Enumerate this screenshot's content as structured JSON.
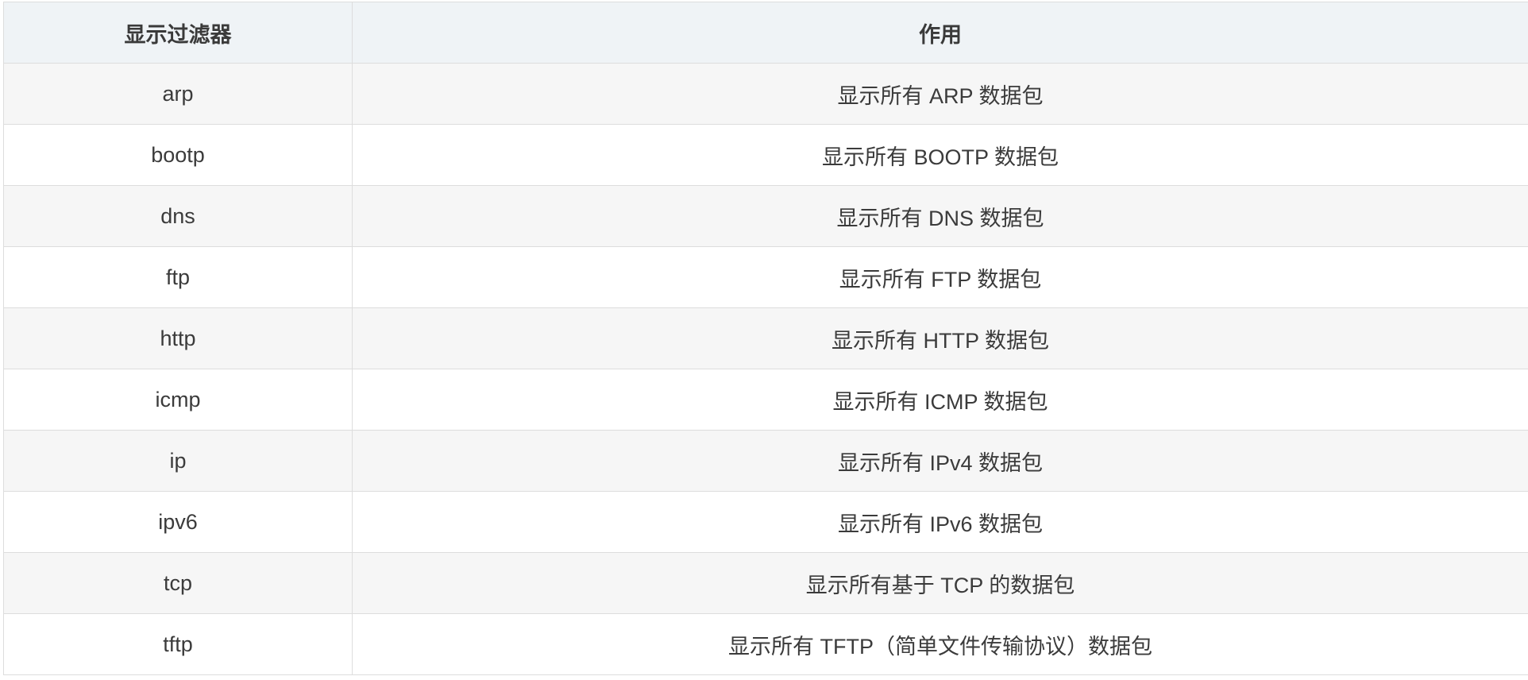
{
  "table": {
    "headers": [
      "显示过滤器",
      "作用"
    ],
    "rows": [
      {
        "filter": "arp",
        "effect": "显示所有 ARP 数据包"
      },
      {
        "filter": "bootp",
        "effect": "显示所有 BOOTP 数据包"
      },
      {
        "filter": "dns",
        "effect": "显示所有 DNS 数据包"
      },
      {
        "filter": "ftp",
        "effect": "显示所有 FTP 数据包"
      },
      {
        "filter": "http",
        "effect": "显示所有 HTTP 数据包"
      },
      {
        "filter": "icmp",
        "effect": "显示所有 ICMP 数据包"
      },
      {
        "filter": "ip",
        "effect": "显示所有 IPv4 数据包"
      },
      {
        "filter": "ipv6",
        "effect": "显示所有 IPv6 数据包"
      },
      {
        "filter": "tcp",
        "effect": "显示所有基于 TCP 的数据包"
      },
      {
        "filter": "tftp",
        "effect": "显示所有 TFTP（简单文件传输协议）数据包"
      }
    ]
  }
}
